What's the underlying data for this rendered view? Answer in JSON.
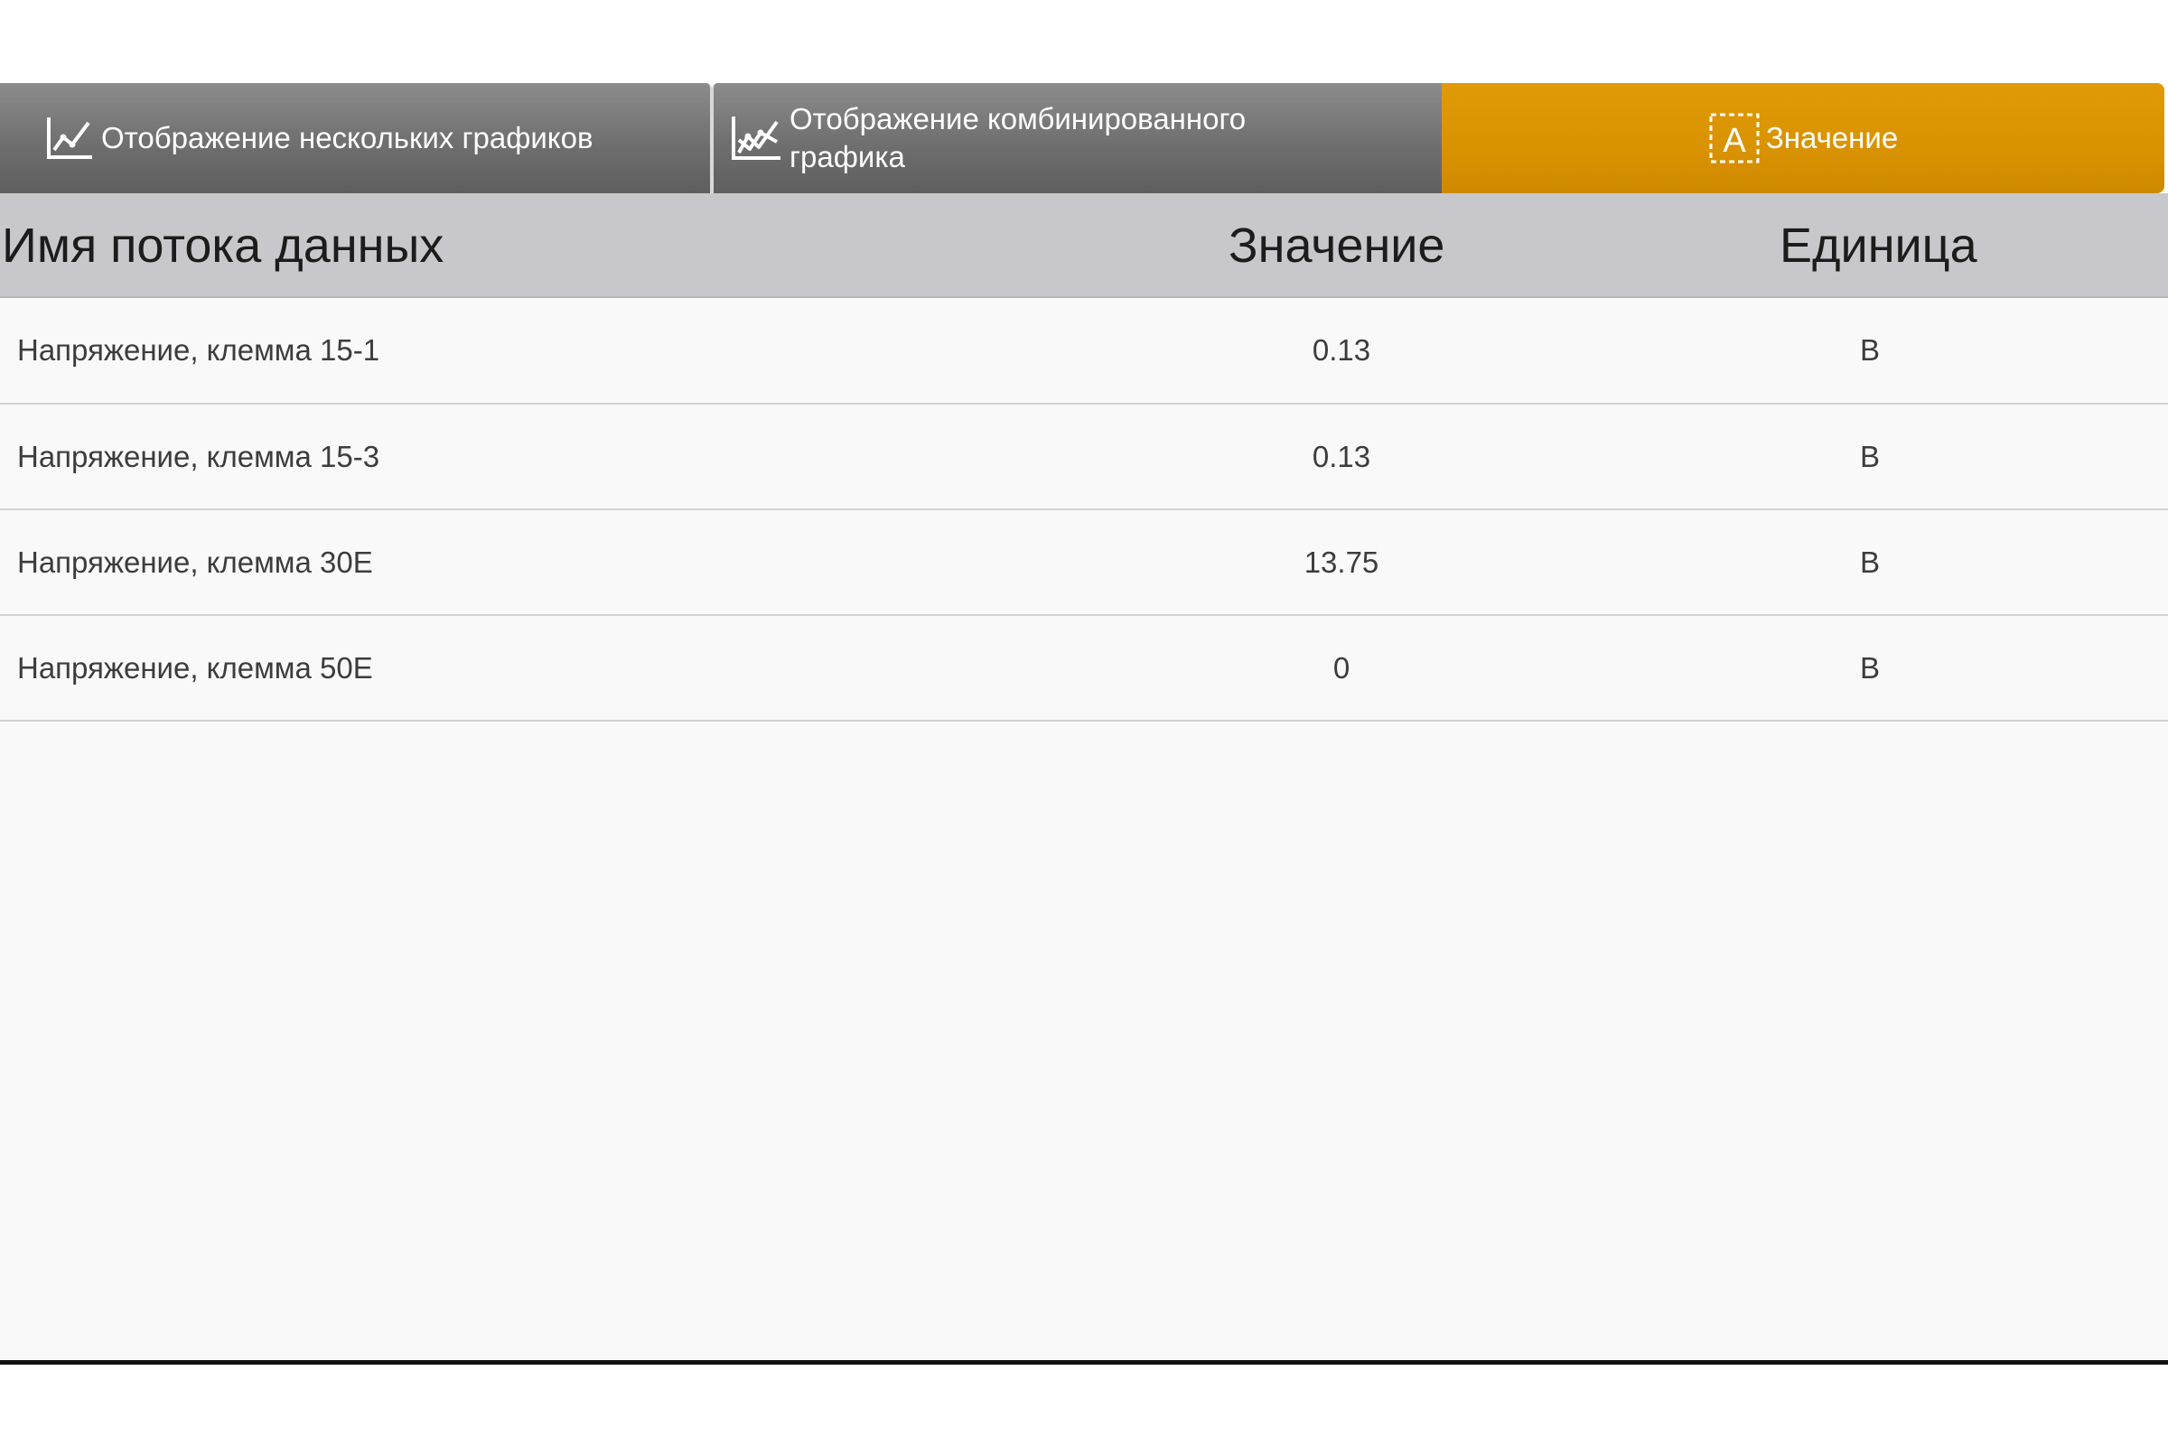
{
  "tabs": {
    "multi_graph": {
      "label": "Отображение нескольких графиков",
      "icon": "line-chart-icon",
      "active": false
    },
    "combined_graph": {
      "label": "Отображение комбинированного графика",
      "icon": "combined-chart-icon",
      "active": false
    },
    "value": {
      "label": "Значение",
      "icon": "text-value-icon",
      "active": true
    }
  },
  "table": {
    "headers": {
      "name": "Имя потока данных",
      "value": "Значение",
      "unit": "Единица"
    },
    "rows": [
      {
        "name": "Напряжение, клемма 15-1",
        "value": "0.13",
        "unit": "В"
      },
      {
        "name": "Напряжение, клемма 15-3",
        "value": "0.13",
        "unit": "В"
      },
      {
        "name": "Напряжение, клемма 30E",
        "value": "13.75",
        "unit": "В"
      },
      {
        "name": "Напряжение, клемма 50E",
        "value": "0",
        "unit": "В"
      }
    ]
  },
  "colors": {
    "active_tab": "#D99200",
    "inactive_tab": "#6F6F6F",
    "header_bg": "#C8C8CC",
    "body_bg": "#F9F9F9"
  }
}
